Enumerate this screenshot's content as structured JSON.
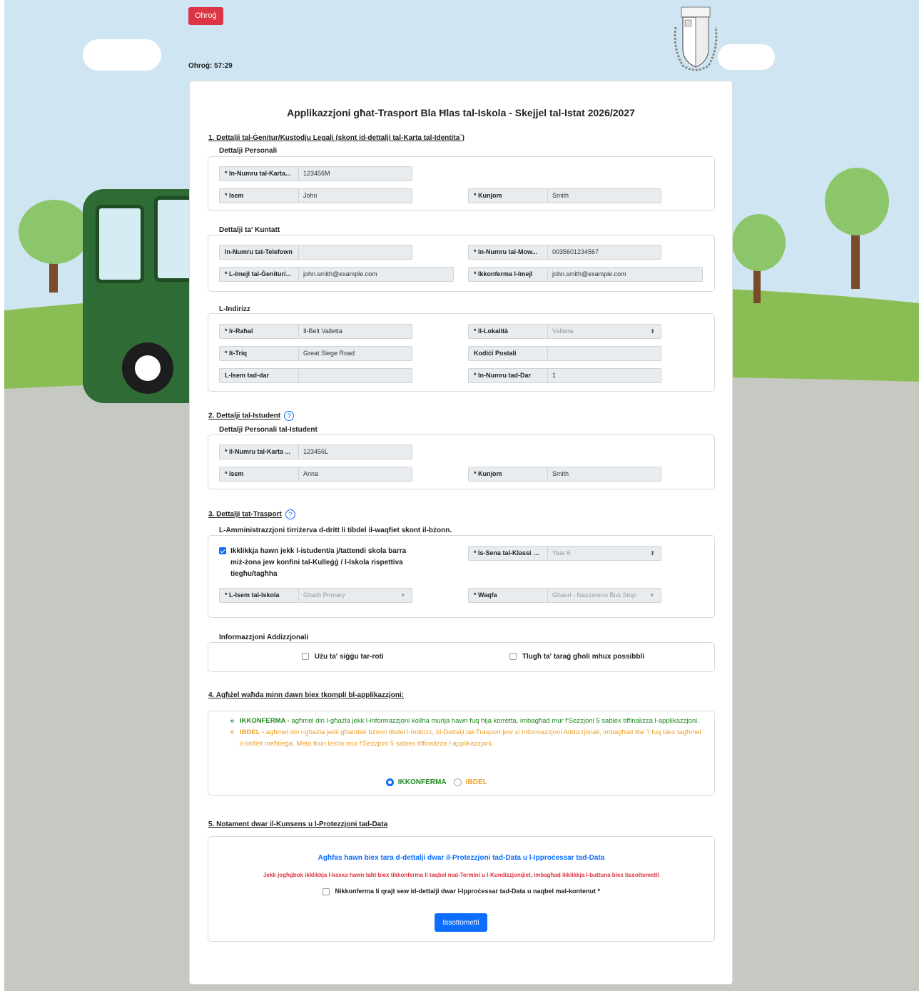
{
  "header": {
    "logout_label": "Ohroġ",
    "timer_label": "Ohroġ:",
    "timer_value": "57:29"
  },
  "title": "Applikazzjoni għat-Trasport Bla Ħlas tal-Iskola - Skejjel tal-Istat 2026/2027",
  "section1": {
    "title": "1. Dettalji tal-Ġenitur/Kustodju Legali (skont id-dettalji tal-Karta tal-Identita`)",
    "personal": {
      "title": "Dettalji Personali",
      "id_label": "* In-Numru tal-Karta...",
      "id_value": "123456M",
      "name_label": "* Isem",
      "name_value": "John",
      "surname_label": "* Kunjom",
      "surname_value": "Smith"
    },
    "contact": {
      "title": "Dettalji ta' Kuntatt",
      "phone_label": "In-Numru tat-Telefown",
      "phone_value": "",
      "mobile_label": "* In-Numru tal-Mow...",
      "mobile_value": "0035601234567",
      "email_label": "* L-Imejl tal-Ġenitur/...",
      "email_value": "john.smith@example.com",
      "email_confirm_label": "* Ikkonferma l-Imejl",
      "email_confirm_value": "john.smith@example.com"
    },
    "address": {
      "title": "L-Indirizz",
      "town_label": "* Ir-Raħal",
      "town_value": "Il-Belt Valletta",
      "locality_label": "* Il-Lokalità",
      "locality_value": "Valletta",
      "street_label": "* It-Triq",
      "street_value": "Great Siege Road",
      "postcode_label": "Kodiċi Postali",
      "postcode_value": "",
      "house_name_label": "L-Isem tad-dar",
      "house_name_value": "",
      "house_number_label": "* In-Numru tad-Dar",
      "house_number_value": "1"
    }
  },
  "section2": {
    "title": "2. Dettalji tal-Istudent",
    "help": "?",
    "personal": {
      "title": "Dettalji Personali tal-Istudent",
      "id_label": "* Il-Numru tal-Karta ...",
      "id_value": "123456L",
      "name_label": "* Isem",
      "name_value": "Anna",
      "surname_label": "* Kunjom",
      "surname_value": "Smith"
    }
  },
  "section3": {
    "title": "3. Dettalji tat-Trasport",
    "help": "?",
    "note": "L-Amministrazzjoni tirriżerva d-dritt li tibdel il-waqfiet skont il-bżonn.",
    "outside_zone_label": "Ikklikkja hawn jekk l-istudent/a j/tattendi skola barra miż-żona jew konfini tal-Kulleġġ / l-Iskola rispettiva tiegħu/tagħha",
    "outside_zone_checked": true,
    "year_label": "* Is-Sena tal-Klassi g...",
    "year_value": "Year 6",
    "school_label": "* L-Isem tal-Iskola",
    "school_value": "Gharb Primary",
    "stop_label": "* Waqfa",
    "stop_value": "Ghasri - Nazzarenu Bus Stop",
    "additional": {
      "title": "Informazzjoni Addizzjonali",
      "wheelchair_label": "Użu ta' siġġu tar-roti",
      "stairs_label": "Tlugħ ta' taraġ għoli mhux possibbli"
    }
  },
  "section4": {
    "title": "4. Agħżel waħda minn dawn biex tkompli bl-applikazzjoni:",
    "confirm_keyword": "IKKONFERMA -",
    "confirm_text": " agħmel din l-għażla jekk l-informazzjoni kollha murija hawn fuq hija korretta, imbagħad mur f'Sezzjoni 5 sabiex tiffinalizza l-applikazzjoni.",
    "change_keyword": "IBDEL -",
    "change_text": " agħmel din l-għażla jekk għandek bżonn tibdel l-Indirizz, id-Dettalji tat-Trasport jew xi Informazzjoni Addizzjonali, imbagħad itla' 'l fuq biex tagħmel il-bidliet meħtieġa. Meta tkun lest/a mur f'Sezzjoni 5 sabiex tiffinalizza l-applikazzjoni.",
    "option_confirm": "IKKONFERMA",
    "option_change": "IBDEL",
    "selected": "confirm"
  },
  "section5": {
    "title": "5. Notament dwar il-Kunsens u l-Protezzjoni tad-Data",
    "link": "Agħfas hawn biex tara d-dettalji dwar il-Protezzjoni tad-Data u l-Ipproċessar tad-Data",
    "warning": "Jekk jogħġbok ikklikkja l-kaxxa hawn taħt biex tikkonferma li taqbel mat-Termini u l-Kundizzjonijiet, imbagħad ikklikkja l-buttuna biex tissottometti",
    "consent_label": "Nikkonferma li qrajt sew id-dettalji dwar l-Ipproċessar tad-Data u naqbel mal-kontenut *",
    "submit_label": "Issottometti"
  },
  "colors": {
    "primary": "#0d6efd",
    "danger": "#dc3545",
    "success": "#1f8a1f",
    "warning": "#f0a02a"
  }
}
